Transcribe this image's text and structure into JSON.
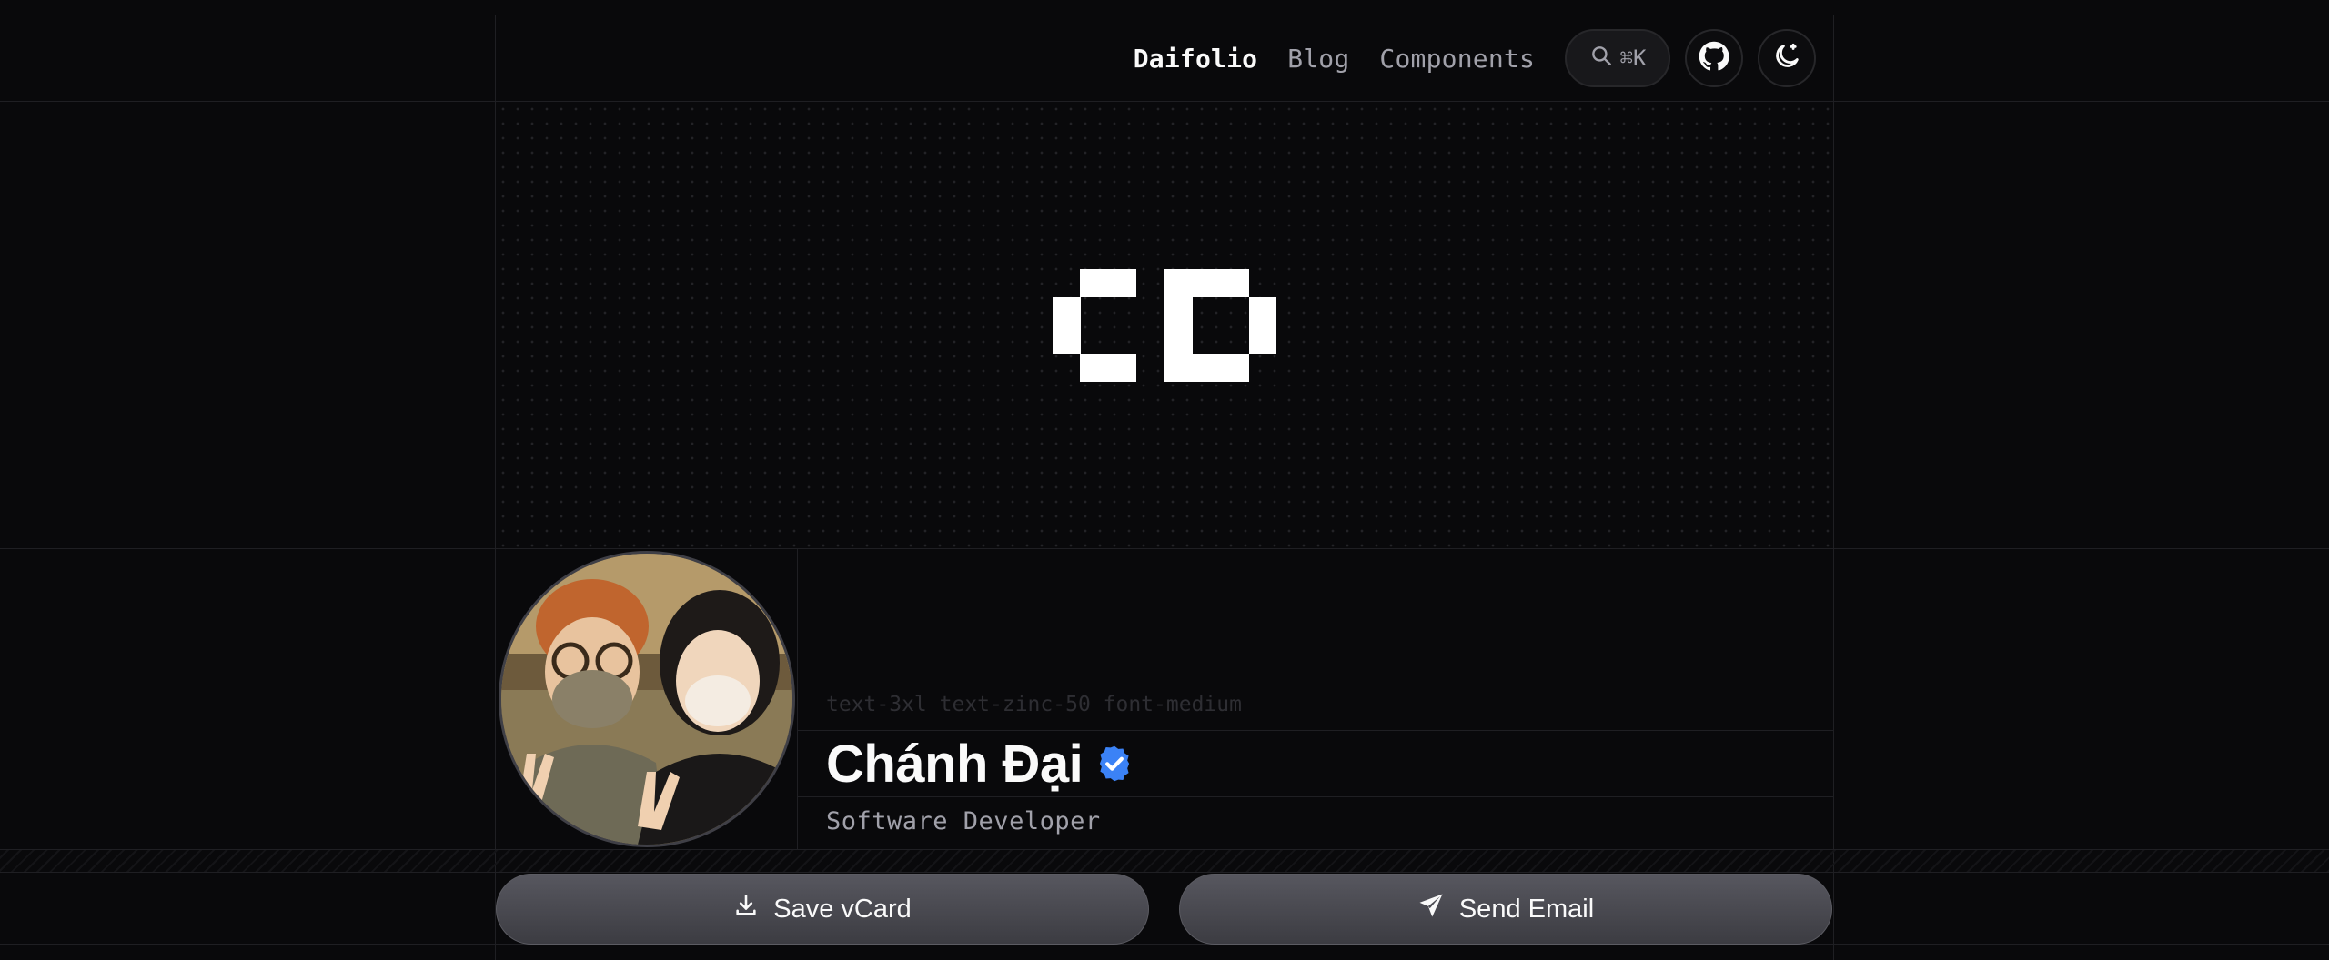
{
  "header": {
    "nav": [
      {
        "label": "Daifolio",
        "active": true
      },
      {
        "label": "Blog",
        "active": false
      },
      {
        "label": "Components",
        "active": false
      }
    ],
    "search_shortcut": "⌘K"
  },
  "profile": {
    "classes_hint": "text-3xl text-zinc-50 font-medium",
    "name": "Chánh Đại",
    "role": "Software Developer",
    "verified": true
  },
  "actions": {
    "save_vcard": "Save vCard",
    "send_email": "Send Email"
  },
  "colors": {
    "background": "#09090b",
    "verified_badge": "#3b82f6",
    "button": "#4a4a50"
  },
  "icons": [
    "search-icon",
    "github-icon",
    "theme-toggle-icon",
    "download-icon",
    "send-icon",
    "verified-badge-icon"
  ]
}
